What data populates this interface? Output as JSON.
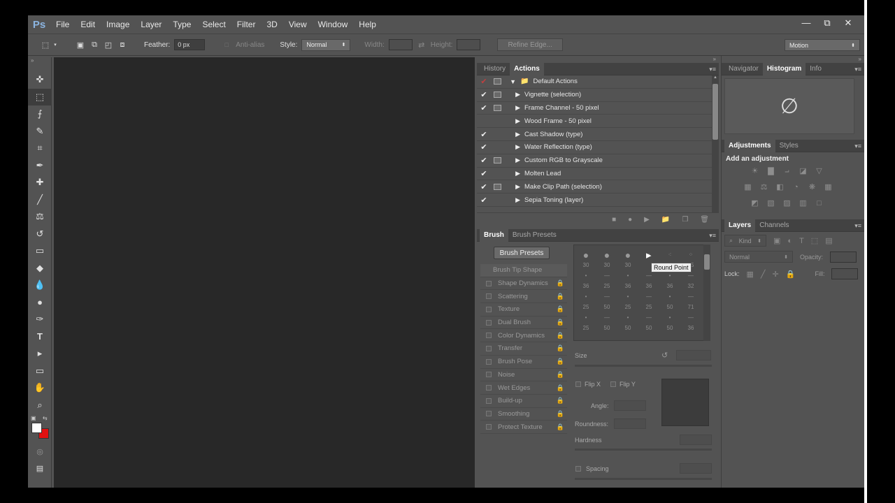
{
  "app": {
    "logo": "Ps"
  },
  "menu": [
    "File",
    "Edit",
    "Image",
    "Layer",
    "Type",
    "Select",
    "Filter",
    "3D",
    "View",
    "Window",
    "Help"
  ],
  "window_controls": {
    "minimize": "—",
    "restore": "⧉",
    "close": "✕"
  },
  "options_bar": {
    "feather_label": "Feather:",
    "feather_value": "0 px",
    "antialias_label": "Anti-alias",
    "style_label": "Style:",
    "style_value": "Normal",
    "width_label": "Width:",
    "height_label": "Height:",
    "refine_edge_label": "Refine Edge...",
    "workspace_value": "Motion"
  },
  "actions_panel": {
    "tabs": [
      "History",
      "Actions"
    ],
    "active_tab": "Actions",
    "items": [
      {
        "check": "✔",
        "dialog": false,
        "label": "Default Actions",
        "is_set": true
      },
      {
        "check": "✔",
        "dialog": true,
        "label": "Vignette (selection)"
      },
      {
        "check": "✔",
        "dialog": true,
        "label": "Frame Channel - 50 pixel"
      },
      {
        "check": "",
        "dialog": false,
        "label": "Wood Frame - 50 pixel"
      },
      {
        "check": "✔",
        "dialog": false,
        "label": "Cast Shadow (type)"
      },
      {
        "check": "✔",
        "dialog": false,
        "label": "Water Reflection (type)"
      },
      {
        "check": "✔",
        "dialog": true,
        "label": "Custom RGB to Grayscale"
      },
      {
        "check": "✔",
        "dialog": false,
        "label": "Molten Lead"
      },
      {
        "check": "✔",
        "dialog": true,
        "label": "Make Clip Path (selection)"
      },
      {
        "check": "✔",
        "dialog": false,
        "label": "Sepia Toning (layer)"
      }
    ]
  },
  "brush_panel": {
    "tabs": [
      "Brush",
      "Brush Presets"
    ],
    "active_tab": "Brush",
    "presets_button": "Brush Presets",
    "options": [
      {
        "label": "Brush Tip Shape",
        "has_checkbox": false
      },
      {
        "label": "Shape Dynamics",
        "has_checkbox": true
      },
      {
        "label": "Scattering",
        "has_checkbox": true
      },
      {
        "label": "Texture",
        "has_checkbox": true
      },
      {
        "label": "Dual Brush",
        "has_checkbox": true
      },
      {
        "label": "Color Dynamics",
        "has_checkbox": true
      },
      {
        "label": "Transfer",
        "has_checkbox": true
      },
      {
        "label": "Brush Pose",
        "has_checkbox": true
      },
      {
        "label": "Noise",
        "has_checkbox": true
      },
      {
        "label": "Wet Edges",
        "has_checkbox": true
      },
      {
        "label": "Build-up",
        "has_checkbox": true
      },
      {
        "label": "Smoothing",
        "has_checkbox": true
      },
      {
        "label": "Protect Texture",
        "has_checkbox": true
      }
    ],
    "brush_sizes": [
      "30",
      "30",
      "30",
      "",
      "",
      "25",
      "",
      "",
      "",
      "",
      "",
      "",
      "36",
      "25",
      "36",
      "36",
      "36",
      "32",
      "",
      "",
      "",
      "",
      "",
      "",
      "25",
      "50",
      "25",
      "25",
      "50",
      "71",
      "",
      "",
      "",
      "",
      "",
      "",
      "25",
      "50",
      "50",
      "50",
      "50",
      "36"
    ],
    "tooltip": "Round Point",
    "size_label": "Size",
    "flipx_label": "Flip X",
    "flipy_label": "Flip Y",
    "angle_label": "Angle:",
    "roundness_label": "Roundness:",
    "hardness_label": "Hardness",
    "spacing_label": "Spacing"
  },
  "navigator_panel": {
    "tabs": [
      "Navigator",
      "Histogram",
      "Info"
    ],
    "active_tab": "Histogram",
    "placeholder_symbol": "∅"
  },
  "adjustments_panel": {
    "tabs": [
      "Adjustments",
      "Styles"
    ],
    "active_tab": "Adjustments",
    "heading": "Add an adjustment"
  },
  "layers_panel": {
    "tabs": [
      "Layers",
      "Channels"
    ],
    "active_tab": "Layers",
    "kind_label": "Kind",
    "blend_mode": "Normal",
    "opacity_label": "Opacity:",
    "lock_label": "Lock:",
    "fill_label": "Fill:"
  },
  "colors": {
    "foreground": "#ffffff",
    "background": "#e01010",
    "accent_check": "#c04040"
  }
}
